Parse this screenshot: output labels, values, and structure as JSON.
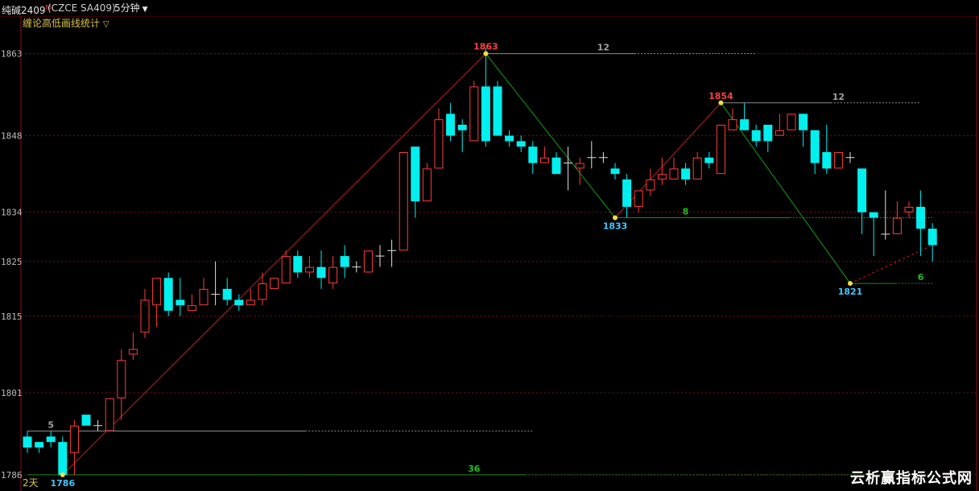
{
  "header": {
    "symbol": "纯碱2409",
    "symbol_mark": "M",
    "code": "(CZCE SA409)",
    "period": "5分钟",
    "period_arrow": "▼"
  },
  "indicator": {
    "name": "缠论高低画线统计",
    "arrow": "▽"
  },
  "watermark": "云析赢指标公式网",
  "colors": {
    "up": "#ff3b3b",
    "down": "#00f0f0",
    "zig_up": "#c02020",
    "zig_down": "#10a010",
    "high_label": "#ff4040",
    "low_label": "#40c8ff",
    "count_gray": "#a0a0a0",
    "count_green": "#20c020"
  },
  "chart_data": {
    "type": "candlestick",
    "y_ticks": [
      1786,
      1801,
      1815,
      1825,
      1834,
      1848,
      1863
    ],
    "ylim": [
      1785.4,
      1865.3
    ],
    "day_label": "2天",
    "candles": [
      [
        1793,
        1791,
        1794,
        1790
      ],
      [
        1792,
        1791,
        1792,
        1790
      ],
      [
        1793,
        1792,
        1794,
        1791
      ],
      [
        1792,
        1786,
        1793,
        1786
      ],
      [
        1790,
        1795,
        1796,
        1786
      ],
      [
        1797,
        1795,
        1797,
        1795
      ],
      [
        1795,
        1795,
        1796,
        1794
      ],
      [
        1794,
        1800,
        1800,
        1794
      ],
      [
        1800,
        1807,
        1809,
        1796
      ],
      [
        1808,
        1809,
        1812,
        1807
      ],
      [
        1812,
        1818,
        1820,
        1811
      ],
      [
        1817,
        1822,
        1822,
        1813
      ],
      [
        1822,
        1816,
        1823,
        1815
      ],
      [
        1818,
        1817,
        1822,
        1815
      ],
      [
        1816,
        1817,
        1819,
        1816
      ],
      [
        1817,
        1820,
        1822,
        1817
      ],
      [
        1819,
        1819,
        1825,
        1817
      ],
      [
        1820,
        1818,
        1822,
        1817
      ],
      [
        1818,
        1817,
        1819,
        1816
      ],
      [
        1817,
        1818,
        1820,
        1817
      ],
      [
        1818,
        1821,
        1823,
        1817
      ],
      [
        1820,
        1822,
        1822,
        1820
      ],
      [
        1821,
        1826,
        1827,
        1821
      ],
      [
        1826,
        1823,
        1827,
        1822
      ],
      [
        1823,
        1824,
        1826,
        1822
      ],
      [
        1824,
        1822,
        1827,
        1820
      ],
      [
        1821,
        1824,
        1826,
        1820
      ],
      [
        1826,
        1824,
        1828,
        1822
      ],
      [
        1824,
        1824,
        1825,
        1823
      ],
      [
        1823,
        1827,
        1827,
        1823
      ],
      [
        1826,
        1826,
        1828,
        1824
      ],
      [
        1827,
        1827,
        1829,
        1824
      ],
      [
        1827,
        1845,
        1845,
        1827
      ],
      [
        1846,
        1836,
        1846,
        1833
      ],
      [
        1836,
        1842,
        1843,
        1836
      ],
      [
        1842,
        1851,
        1853,
        1842
      ],
      [
        1852,
        1848,
        1854,
        1847
      ],
      [
        1850,
        1849,
        1851,
        1845
      ],
      [
        1847,
        1857,
        1858,
        1847
      ],
      [
        1857,
        1847,
        1864,
        1846
      ],
      [
        1857,
        1848,
        1858,
        1848
      ],
      [
        1848,
        1847,
        1849,
        1846
      ],
      [
        1847,
        1846,
        1848,
        1845
      ],
      [
        1846,
        1843,
        1847,
        1841
      ],
      [
        1843,
        1844,
        1846,
        1843
      ],
      [
        1844,
        1841,
        1845,
        1841
      ],
      [
        1843,
        1843,
        1846,
        1838
      ],
      [
        1842,
        1843,
        1844,
        1839
      ],
      [
        1844,
        1844,
        1847,
        1842
      ],
      [
        1844,
        1844,
        1845,
        1843
      ],
      [
        1842,
        1841,
        1843,
        1840
      ],
      [
        1840,
        1835,
        1841,
        1833
      ],
      [
        1835,
        1838,
        1838,
        1834
      ],
      [
        1838,
        1840,
        1842,
        1837
      ],
      [
        1840,
        1841,
        1844,
        1839
      ],
      [
        1840,
        1842,
        1844,
        1840
      ],
      [
        1842,
        1840,
        1843,
        1839
      ],
      [
        1840,
        1844,
        1845,
        1840
      ],
      [
        1844,
        1843,
        1845,
        1842
      ],
      [
        1841,
        1850,
        1850,
        1841
      ],
      [
        1849,
        1851,
        1853,
        1849
      ],
      [
        1851,
        1849,
        1854,
        1849
      ],
      [
        1849,
        1847,
        1850,
        1846
      ],
      [
        1850,
        1847,
        1850,
        1845
      ],
      [
        1848,
        1849,
        1852,
        1848
      ],
      [
        1849,
        1852,
        1852,
        1849
      ],
      [
        1852,
        1849,
        1852,
        1846
      ],
      [
        1849,
        1843,
        1849,
        1841
      ],
      [
        1845,
        1842,
        1850,
        1841
      ],
      [
        1842,
        1845,
        1845,
        1842
      ],
      [
        1844,
        1844,
        1845,
        1843
      ],
      [
        1842,
        1834,
        1842,
        1830
      ],
      [
        1834,
        1833,
        1834,
        1826
      ],
      [
        1830,
        1830,
        1838,
        1829
      ],
      [
        1830,
        1833,
        1836,
        1831
      ],
      [
        1834,
        1835,
        1836,
        1833
      ],
      [
        1835,
        1831,
        1838,
        1826
      ],
      [
        1831,
        1828,
        1832,
        1825
      ]
    ],
    "zigzag": [
      {
        "i": 3,
        "price": 1786,
        "label": "1786",
        "kind": "low"
      },
      {
        "i": 39,
        "price": 1863,
        "label": "1863",
        "kind": "high"
      },
      {
        "i": 50,
        "price": 1833,
        "label": "1833",
        "kind": "low"
      },
      {
        "i": 59,
        "price": 1854,
        "label": "1854",
        "kind": "high"
      },
      {
        "i": 70,
        "price": 1821,
        "label": "1821",
        "kind": "low"
      }
    ],
    "projection": {
      "from_i": 70,
      "from_price": 1821,
      "to_i": 77,
      "to_price": 1828
    },
    "level_counts": [
      {
        "price": 1863,
        "start_i": 39,
        "end_i": 62,
        "count": "12",
        "color": "gray",
        "count_i": 49
      },
      {
        "price": 1854,
        "start_i": 59,
        "end_i": 76,
        "count": "12",
        "color": "gray",
        "count_i": 69
      },
      {
        "price": 1833,
        "start_i": 50,
        "end_i": 77,
        "count": "8",
        "color": "green",
        "count_i": 56
      },
      {
        "price": 1821,
        "start_i": 70,
        "end_i": 77,
        "count": "6",
        "color": "green",
        "count_i": 76
      },
      {
        "price": 1794,
        "start_i": 0,
        "end_i": 43,
        "count": "5",
        "color": "gray",
        "count_i": 2
      },
      {
        "price": 1786,
        "start_i": 0,
        "end_i": 77,
        "count": "36",
        "color": "green",
        "count_i": 38
      }
    ]
  }
}
